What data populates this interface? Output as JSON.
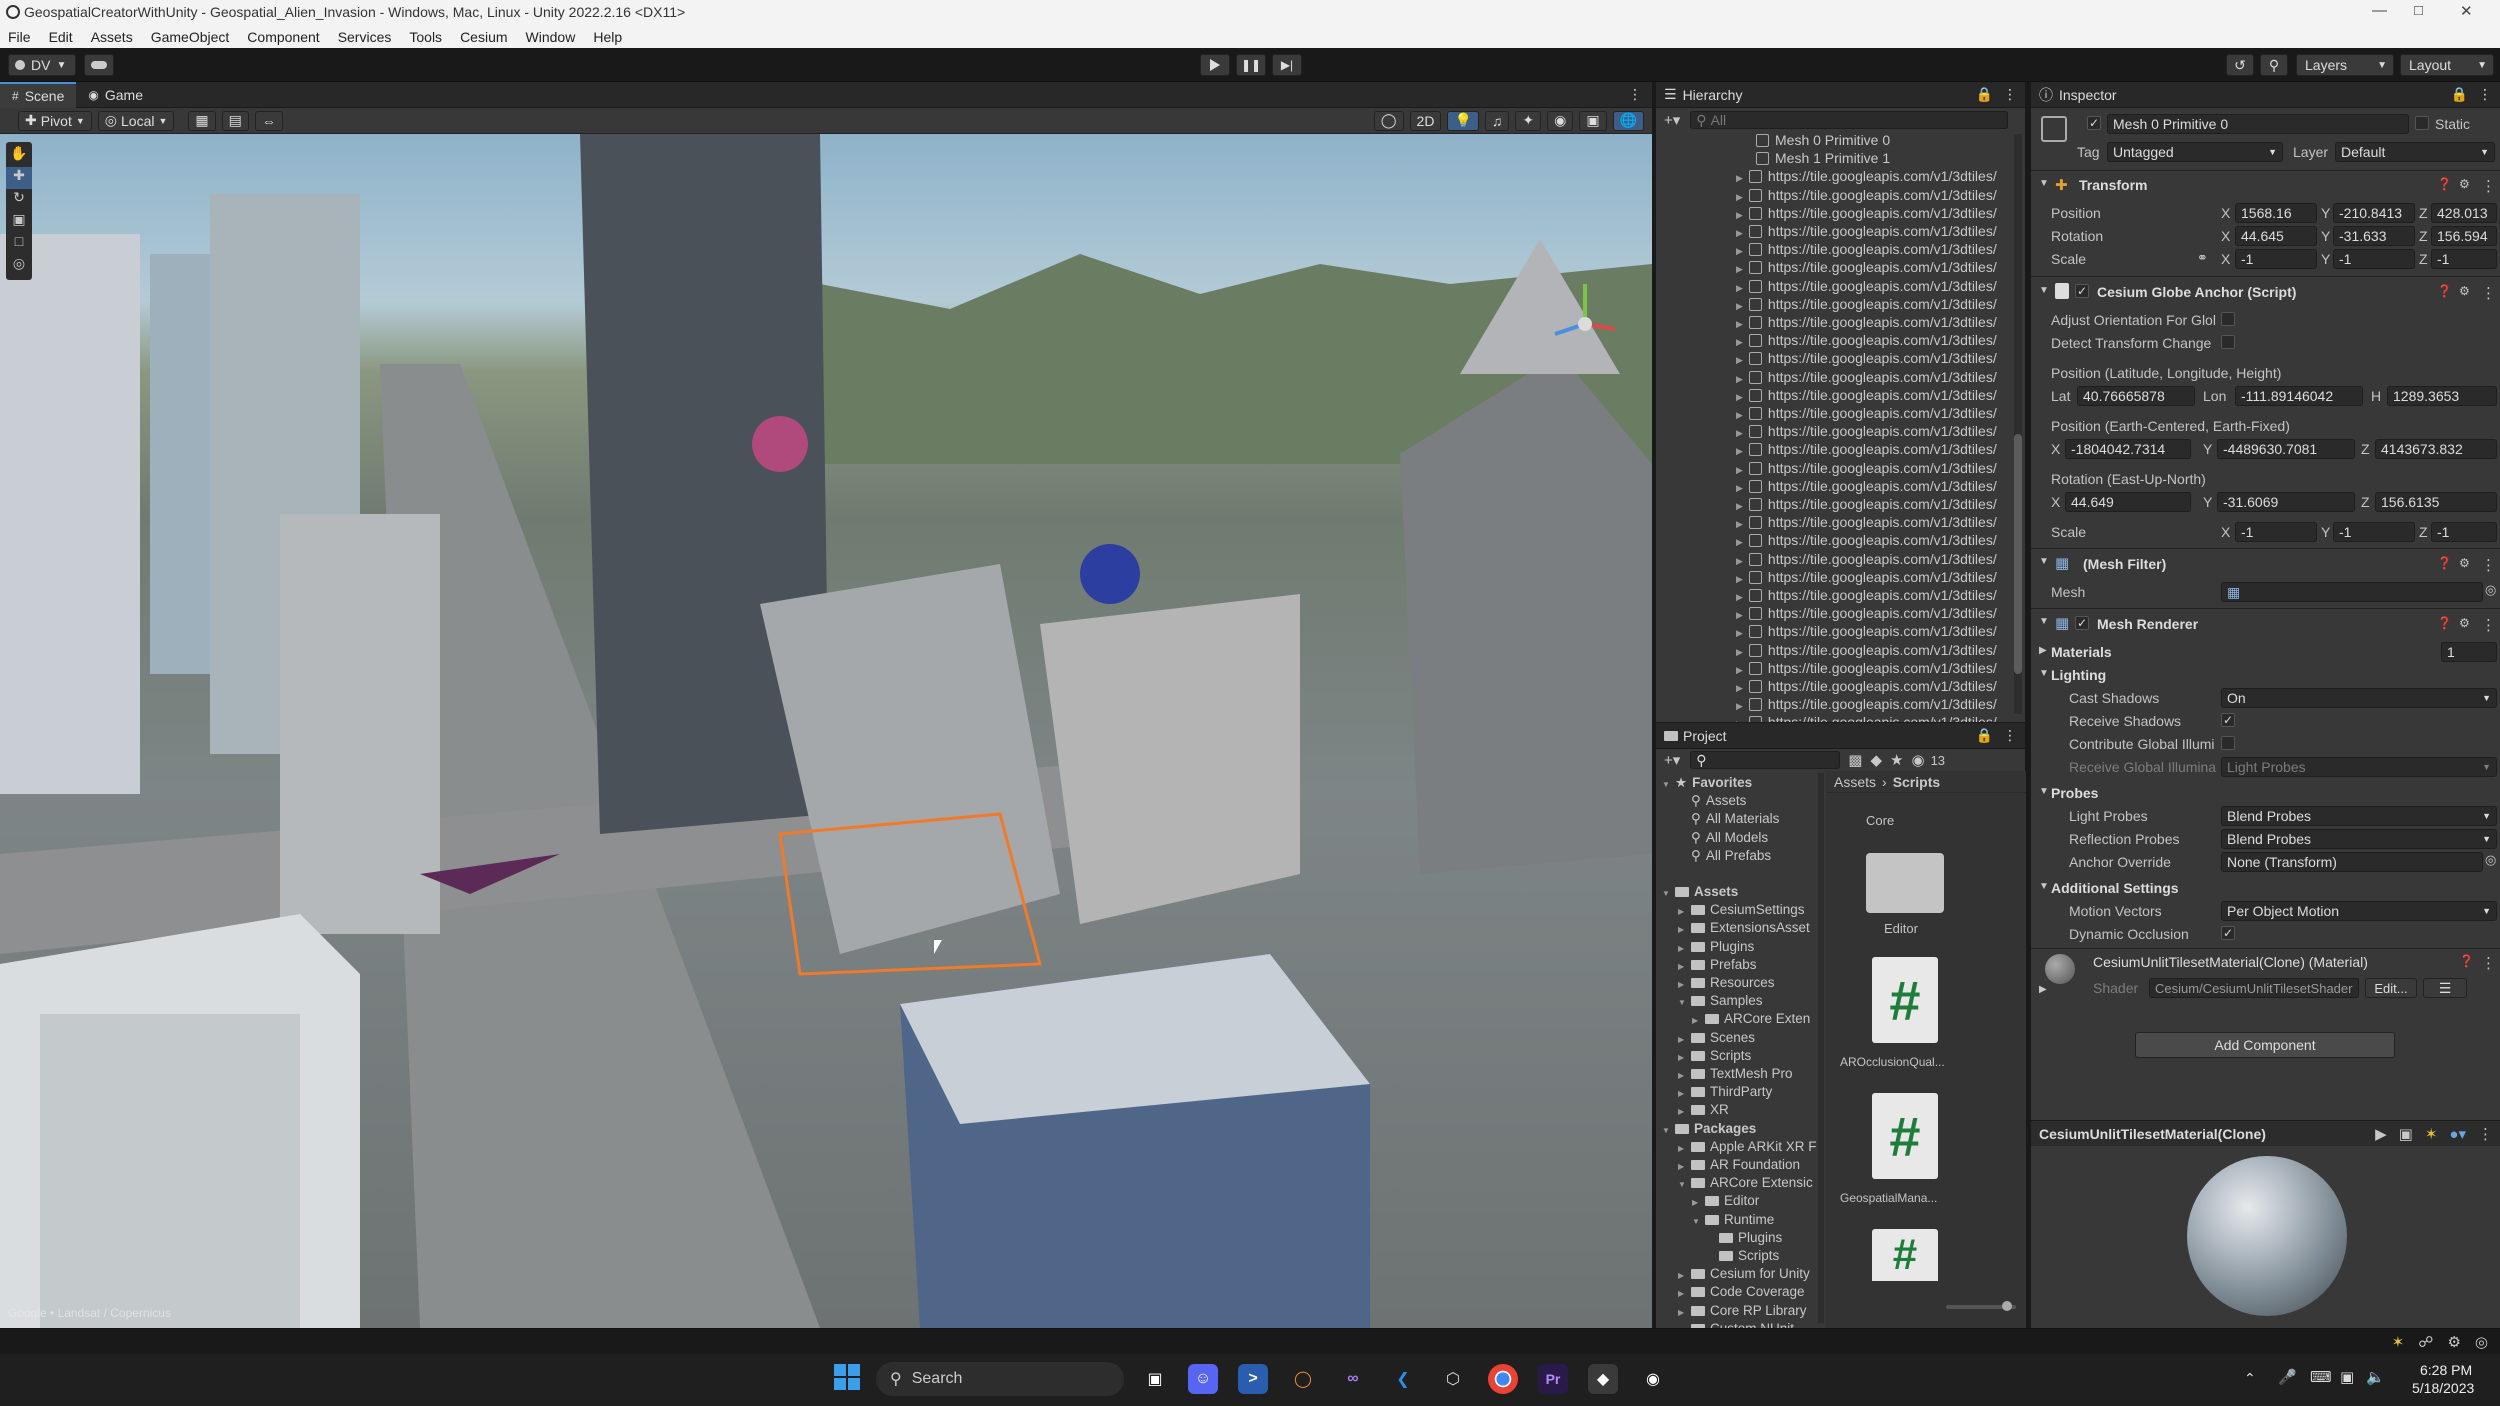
{
  "window": {
    "title": "GeospatialCreatorWithUnity - Geospatial_Alien_Invasion - Windows, Mac, Linux - Unity 2022.2.16 <DX11>"
  },
  "menu": [
    "File",
    "Edit",
    "Assets",
    "GameObject",
    "Component",
    "Services",
    "Tools",
    "Cesium",
    "Window",
    "Help"
  ],
  "toolbar": {
    "account": "DV",
    "layers": "Layers",
    "layout": "Layout"
  },
  "scene": {
    "tabs": [
      "Scene",
      "Game"
    ],
    "pivot": "Pivot",
    "local": "Local",
    "mode_2d": "2D",
    "attribution": "Google • Landsat / Copernicus"
  },
  "hierarchy": {
    "title": "Hierarchy",
    "search_placeholder": "All",
    "top_items": [
      "Mesh 0 Primitive 0",
      "Mesh 1 Primitive 1"
    ],
    "tile_url": "https://tile.googleapis.com/v1/3dtiles/",
    "tile_count": 31
  },
  "project": {
    "title": "Project",
    "count": "13",
    "favorites_label": "Favorites",
    "favorites": [
      "Assets",
      "All Materials",
      "All Models",
      "All Prefabs"
    ],
    "assets_label": "Assets",
    "assets": [
      "CesiumSettings",
      "ExtensionsAsset",
      "Plugins",
      "Prefabs",
      "Resources",
      "Samples",
      "ARCore Exten",
      "Scenes",
      "Scripts",
      "TextMesh Pro",
      "ThirdParty",
      "XR"
    ],
    "packages_label": "Packages",
    "packages": [
      "Apple ARKit XR F",
      "AR Foundation",
      "ARCore Extensic",
      "Editor",
      "Runtime",
      "Plugins",
      "Scripts",
      "Cesium for Unity",
      "Code Coverage",
      "Core RP Library",
      "Custom NUnit"
    ],
    "breadcrumb": [
      "Assets",
      "Scripts"
    ],
    "grid_items": [
      "Core",
      "Editor",
      "AROcclusionQual...",
      "GeospatialMana..."
    ]
  },
  "inspector": {
    "title": "Inspector",
    "object_name": "Mesh 0 Primitive 0",
    "static_label": "Static",
    "tag_label": "Tag",
    "tag": "Untagged",
    "layer_label": "Layer",
    "layer": "Default",
    "transform": {
      "title": "Transform",
      "position_label": "Position",
      "rotation_label": "Rotation",
      "scale_label": "Scale",
      "position": {
        "x": "1568.16",
        "y": "-210.8413",
        "z": "428.013"
      },
      "rotation": {
        "x": "44.645",
        "y": "-31.633",
        "z": "156.594"
      },
      "scale": {
        "x": "-1",
        "y": "-1",
        "z": "-1"
      }
    },
    "globe_anchor": {
      "title": "Cesium Globe Anchor (Script)",
      "adjust": "Adjust Orientation For Glol",
      "detect": "Detect Transform Change",
      "llh_label": "Position (Latitude, Longitude, Height)",
      "lat_label": "Lat",
      "lat": "40.76665878",
      "lon_label": "Lon",
      "lon": "-111.89146042",
      "h_label": "H",
      "h": "1289.3653",
      "ecef_label": "Position (Earth-Centered, Earth-Fixed)",
      "ecef": {
        "x": "-1804042.7314",
        "y": "-4489630.7081",
        "z": "4143673.832"
      },
      "eun_label": "Rotation (East-Up-North)",
      "eun": {
        "x": "44.649",
        "y": "-31.6069",
        "z": "156.6135"
      },
      "scale_label": "Scale",
      "scale": {
        "x": "-1",
        "y": "-1",
        "z": "-1"
      }
    },
    "mesh_filter": {
      "title": "(Mesh Filter)",
      "mesh_label": "Mesh"
    },
    "mesh_renderer": {
      "title": "Mesh Renderer",
      "materials_label": "Materials",
      "materials_count": "1",
      "lighting_label": "Lighting",
      "cast_shadows_label": "Cast Shadows",
      "cast_shadows": "On",
      "receive_shadows_label": "Receive Shadows",
      "contribute_gi_label": "Contribute Global Illumi",
      "receive_gi_label": "Receive Global Illumina",
      "receive_gi": "Light Probes",
      "probes_label": "Probes",
      "light_probes_label": "Light Probes",
      "light_probes": "Blend Probes",
      "reflection_probes_label": "Reflection Probes",
      "reflection_probes": "Blend Probes",
      "anchor_override_label": "Anchor Override",
      "anchor_override": "None (Transform)",
      "additional_label": "Additional Settings",
      "motion_vectors_label": "Motion Vectors",
      "motion_vectors": "Per Object Motion",
      "dynamic_occlusion_label": "Dynamic Occlusion"
    },
    "material": {
      "name": "CesiumUnlitTilesetMaterial(Clone) (Material)",
      "shader_label": "Shader",
      "shader": "Cesium/CesiumUnlitTilesetShader",
      "edit": "Edit..."
    },
    "add_component": "Add Component",
    "preview_title": "CesiumUnlitTilesetMaterial(Clone)"
  },
  "taskbar": {
    "search": "Search",
    "time": "6:28 PM",
    "date": "5/18/2023"
  }
}
